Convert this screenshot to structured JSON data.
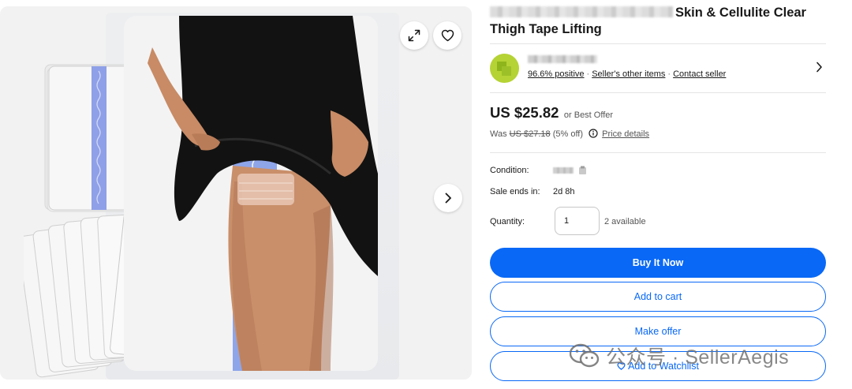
{
  "listing": {
    "title_visible": "Skin & Cellulite Clear Thigh Tape Lifting"
  },
  "seller": {
    "positive": "96.6% positive",
    "other_items": "Seller's other items",
    "contact": "Contact seller",
    "separator": "·"
  },
  "pricing": {
    "price": "US $25.82",
    "offer_note": "or Best Offer",
    "was_label": "Was",
    "was_price": "US $27.18",
    "discount": "(5% off)",
    "price_details": "Price details"
  },
  "details": {
    "condition_label": "Condition:",
    "sale_ends_label": "Sale ends in:",
    "sale_ends_value": "2d 8h",
    "quantity_label": "Quantity:",
    "quantity_value": "1",
    "available": "2 available"
  },
  "actions": {
    "buy_now": "Buy It Now",
    "add_to_cart": "Add to cart",
    "make_offer": "Make offer",
    "watchlist": "Add to Watchlist"
  },
  "watermark": {
    "text": "公众号 · SellerAegis"
  },
  "colors": {
    "primary": "#0968f6",
    "text": "#191919",
    "avatar": "#b5d334"
  },
  "icons": {
    "expand": "expand-icon",
    "heart": "heart-icon",
    "next": "chevron-right-icon",
    "info": "info-icon"
  }
}
